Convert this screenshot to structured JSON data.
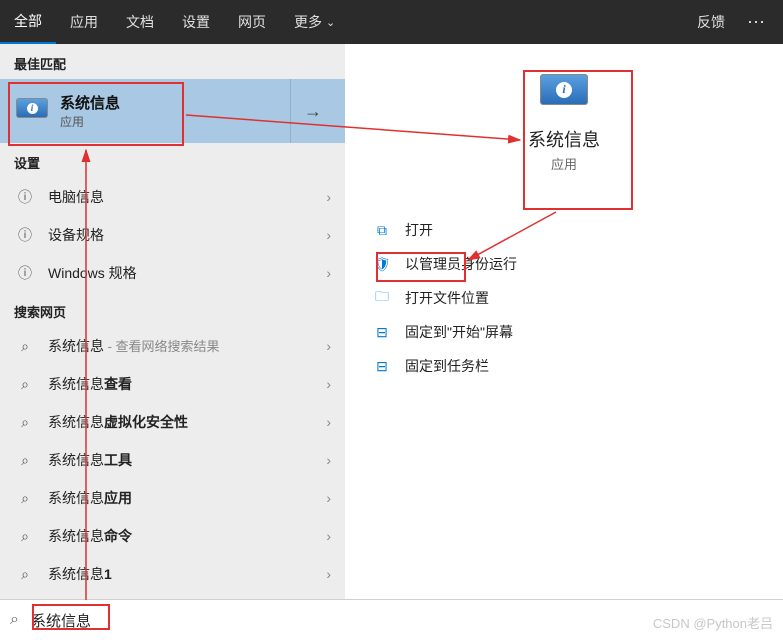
{
  "topbar": {
    "tabs": [
      "全部",
      "应用",
      "文档",
      "设置",
      "网页",
      "更多"
    ],
    "active_index": 0,
    "feedback": "反馈",
    "more_glyph": "⋯"
  },
  "left": {
    "best_match_header": "最佳匹配",
    "best_match": {
      "title": "系统信息",
      "subtitle": "应用",
      "arrow": "→"
    },
    "settings_header": "设置",
    "settings": [
      {
        "label": "电脑信息"
      },
      {
        "label": "设备规格"
      },
      {
        "label": "Windows 规格"
      }
    ],
    "web_header": "搜索网页",
    "web": [
      {
        "prefix": "系统信息",
        "bold": "",
        "hint": " - 查看网络搜索结果"
      },
      {
        "prefix": "系统信息",
        "bold": "查看",
        "hint": ""
      },
      {
        "prefix": "系统信息",
        "bold": "虚拟化安全性",
        "hint": ""
      },
      {
        "prefix": "系统信息",
        "bold": "工具",
        "hint": ""
      },
      {
        "prefix": "系统信息",
        "bold": "应用",
        "hint": ""
      },
      {
        "prefix": "系统信息",
        "bold": "命令",
        "hint": ""
      },
      {
        "prefix": "系统信息",
        "bold": "1",
        "hint": ""
      }
    ]
  },
  "right": {
    "title": "系统信息",
    "subtitle": "应用",
    "actions": [
      {
        "icon": "open-icon",
        "glyph": "⧉",
        "label": "打开"
      },
      {
        "icon": "admin-icon",
        "glyph": "🛡",
        "label": "以管理员身份运行"
      },
      {
        "icon": "folder-icon",
        "glyph": "🗀",
        "label": "打开文件位置"
      },
      {
        "icon": "pin-start-icon",
        "glyph": "⊟",
        "label": "固定到\"开始\"屏幕"
      },
      {
        "icon": "pin-taskbar-icon",
        "glyph": "⊟",
        "label": "固定到任务栏"
      }
    ]
  },
  "search": {
    "value": "系统信息",
    "icon": "⌕"
  },
  "watermark": "CSDN @Python老吕",
  "glyphs": {
    "chevron_right": "›",
    "info": "ⓘ",
    "search": "⌕",
    "dropdown": "⌄"
  }
}
